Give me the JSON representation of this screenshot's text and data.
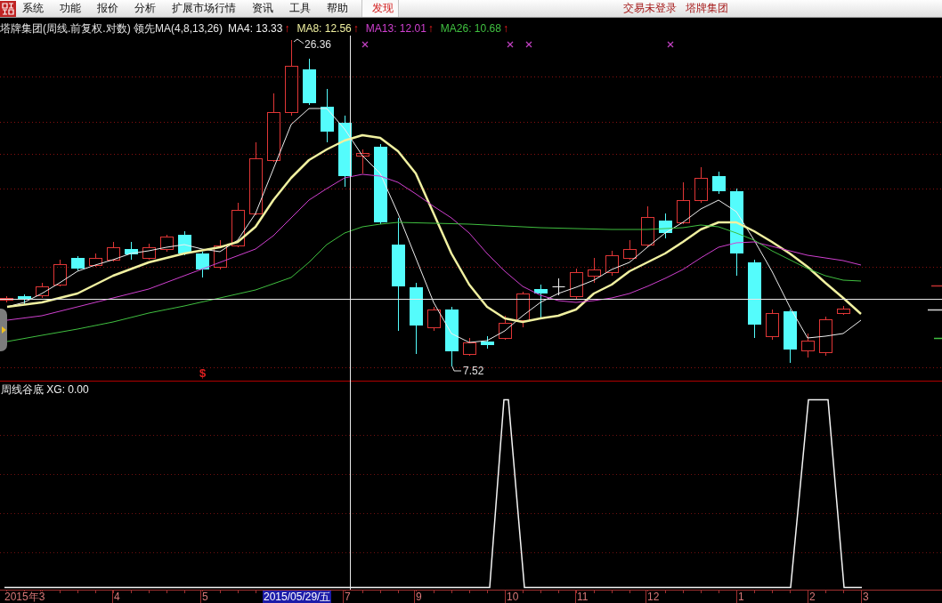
{
  "menu_bar": {
    "items": [
      {
        "label": "系统",
        "kind": "menu"
      },
      {
        "label": "功能",
        "kind": "menu"
      },
      {
        "label": "报价",
        "kind": "menu"
      },
      {
        "label": "分析",
        "kind": "menu"
      },
      {
        "label": "扩展市场行情",
        "kind": "menu"
      },
      {
        "label": "资讯",
        "kind": "menu"
      },
      {
        "label": "工具",
        "kind": "menu"
      },
      {
        "label": "帮助",
        "kind": "menu"
      },
      {
        "label": "发现",
        "kind": "featured"
      }
    ],
    "status_items": [
      "交易未登录",
      "塔牌集团"
    ]
  },
  "main_chart": {
    "title": "塔牌集团(周线.前复权.对数) 领先MA(4,8,13,26)",
    "legend": [
      {
        "label": "MA4: 13.33",
        "color": "#f0f0f0",
        "trend": "↑"
      },
      {
        "label": "MA8: 12.56",
        "color": "#f0f0a0",
        "trend": "↑"
      },
      {
        "label": "MA13: 12.01",
        "color": "#d040d0",
        "trend": "↑"
      },
      {
        "label": "MA26: 10.68",
        "color": "#40c040",
        "trend": "↑"
      }
    ],
    "high_label": "26.36",
    "low_label": "7.52",
    "event_mark": "$"
  },
  "indicator_panel": {
    "title": "周线谷底 XG: 0.00"
  },
  "time_axis": {
    "labels": [
      "2015年3",
      "4",
      "5",
      "7",
      "9",
      "10",
      "11",
      "12",
      "1",
      "2",
      "3"
    ],
    "cursor_label": "2015/05/29/五"
  }
}
